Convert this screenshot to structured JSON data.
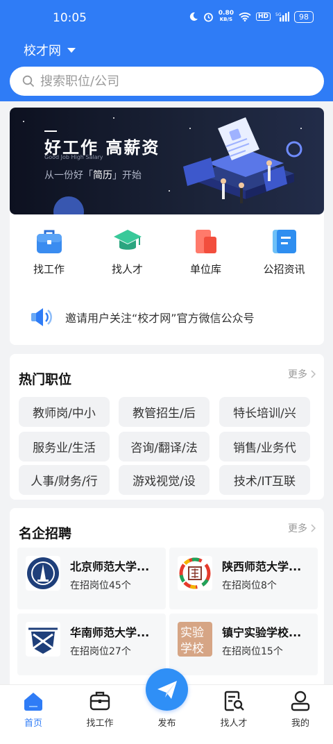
{
  "status": {
    "time": "10:05",
    "net_speed": "0.80",
    "net_unit": "KB/S",
    "hd": "HD",
    "signal": "5G",
    "battery": "98"
  },
  "header": {
    "city": "校才网",
    "search_placeholder": "搜索职位/公司"
  },
  "banner": {
    "title": "好工作 高薪资",
    "subtitle_en": "Good Job   High Salary",
    "tagline_pre": "从一份好「",
    "tagline_key": "简历",
    "tagline_post": "」开始"
  },
  "quick": [
    {
      "label": "找工作",
      "icon": "briefcase-icon"
    },
    {
      "label": "找人才",
      "icon": "graduation-cap-icon"
    },
    {
      "label": "单位库",
      "icon": "building-icon"
    },
    {
      "label": "公招资讯",
      "icon": "news-icon"
    }
  ],
  "notice": {
    "text": "邀请用户关注“校才网”官方微信公众号",
    "icon": "speaker-icon"
  },
  "hot_jobs": {
    "title": "热门职位",
    "more": "更多",
    "items": [
      "教师岗/中小",
      "教管招生/后",
      "特长培训/兴",
      "服务业/生活",
      "咨询/翻译/法",
      "销售/业务代",
      "人事/财务/行",
      "游戏视觉/设",
      "技术/IT互联"
    ]
  },
  "companies": {
    "title": "名企招聘",
    "more": "更多",
    "items": [
      {
        "name": "北京师范大学...",
        "count": "在招岗位45个"
      },
      {
        "name": "陕西师范大学...",
        "count": "在招岗位8个"
      },
      {
        "name": "华南师范大学...",
        "count": "在招岗位27个"
      },
      {
        "name": "镇宁实验学校...",
        "count": "在招岗位15个"
      }
    ],
    "logo4_text": "实验学校"
  },
  "tabs": [
    {
      "label": "首页",
      "icon": "home-icon",
      "active": true
    },
    {
      "label": "找工作",
      "icon": "briefcase-icon"
    },
    {
      "label": "发布",
      "icon": "send-icon"
    },
    {
      "label": "找人才",
      "icon": "search-resume-icon"
    },
    {
      "label": "我的",
      "icon": "user-icon"
    }
  ],
  "colors": {
    "primary": "#2f7cf6",
    "background": "#f2f3f5"
  }
}
